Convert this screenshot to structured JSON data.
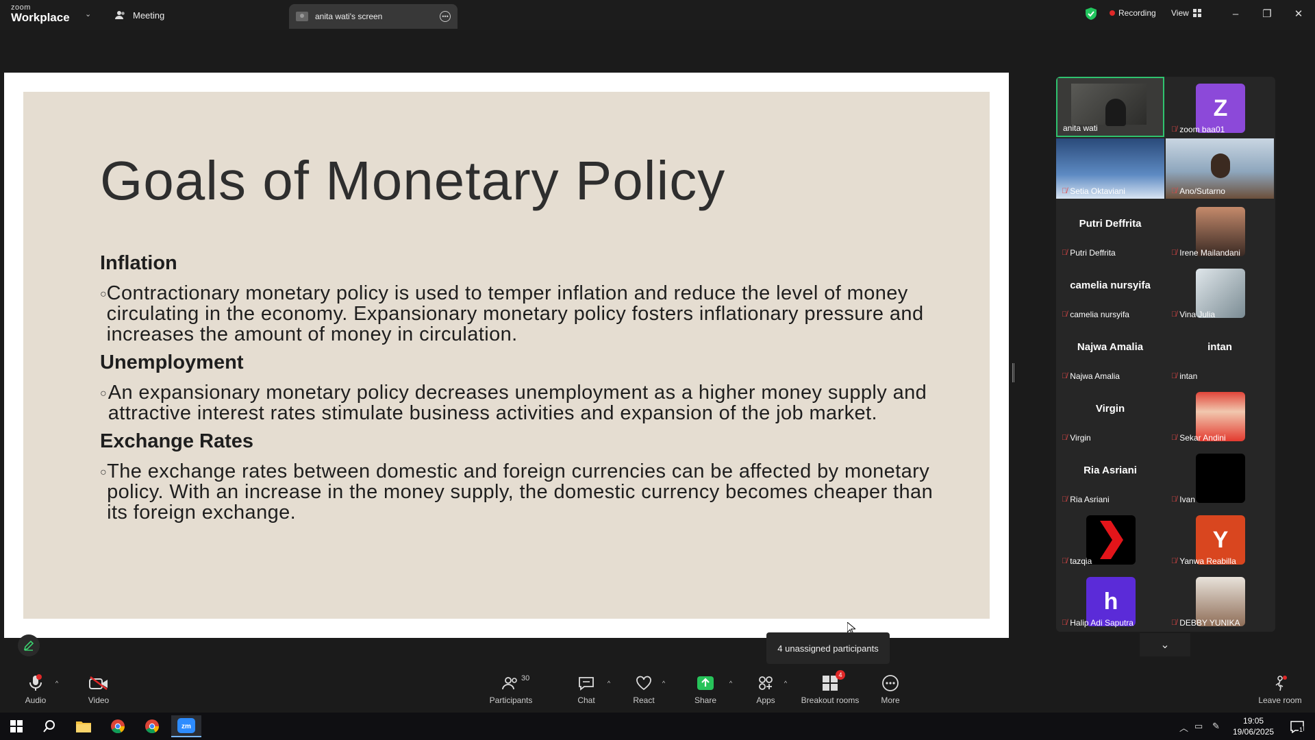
{
  "app": {
    "logo_line1": "zoom",
    "logo_line2": "Workplace",
    "meeting_tab": "Meeting",
    "screen_tab": "anita wati's screen",
    "recording_label": "Recording",
    "view_label": "View"
  },
  "slide": {
    "title": "Goals of Monetary Policy",
    "sections": [
      {
        "heading": "Inflation",
        "text": "Contractionary monetary policy is used to temper inflation and reduce the level of money circulating in the economy. Expansionary monetary policy fosters inflationary pressure and increases the amount of money in circulation."
      },
      {
        "heading": "Unemployment",
        "text": "An expansionary monetary policy decreases unemployment as a higher money supply and attractive interest rates stimulate business activities and expansion of the job market."
      },
      {
        "heading": "Exchange Rates",
        "text": "The exchange rates between domestic and foreign currencies can be affected by monetary policy. With an increase in the money supply, the domestic currency becomes cheaper than its foreign exchange."
      }
    ]
  },
  "participants": [
    {
      "name": "anita wati",
      "kind": "video-dark"
    },
    {
      "name": "zoom baa01",
      "kind": "avatar",
      "letter": "Z",
      "color": "#8c49d9"
    },
    {
      "name": "Setia Oktaviani",
      "kind": "video-blue"
    },
    {
      "name": "Ano/Sutarno",
      "kind": "video-office"
    },
    {
      "name": "Putri Deffrita",
      "kind": "text"
    },
    {
      "name": "Irene Mailandani",
      "kind": "photo"
    },
    {
      "name": "camelia nursyifa",
      "kind": "text"
    },
    {
      "name": "Vina Julia",
      "kind": "photo"
    },
    {
      "name": "Najwa Amalia",
      "kind": "text"
    },
    {
      "name": "intan",
      "kind": "text"
    },
    {
      "name": "Virgin",
      "kind": "text"
    },
    {
      "name": "Sekar Andini",
      "kind": "photo-red"
    },
    {
      "name": "Ria Asriani",
      "kind": "text"
    },
    {
      "name": "Ivan",
      "kind": "black"
    },
    {
      "name": "tazqia",
      "kind": "logo"
    },
    {
      "name": "Yanwa Reabilla",
      "kind": "avatar",
      "letter": "Y",
      "color": "#d9461f"
    },
    {
      "name": "Halip Adi Saputra",
      "kind": "avatar",
      "letter": "h",
      "color": "#5b2bd8"
    },
    {
      "name": "DEBBY YUNIKA",
      "kind": "photo"
    }
  ],
  "tooltip": "4 unassigned participants",
  "toolbar": {
    "audio": "Audio",
    "video": "Video",
    "participants": "Participants",
    "participants_count": "30",
    "chat": "Chat",
    "react": "React",
    "share": "Share",
    "apps": "Apps",
    "breakout": "Breakout rooms",
    "breakout_badge": "4",
    "more": "More",
    "leave": "Leave room"
  },
  "taskbar": {
    "time": "19:05",
    "date": "19/06/2025",
    "notif_count": "1"
  },
  "colors": {
    "slide_bg": "#e5ddd1",
    "active_speaker": "#2fc36f",
    "share_green": "#27c35a",
    "muted_red": "#e24848"
  }
}
